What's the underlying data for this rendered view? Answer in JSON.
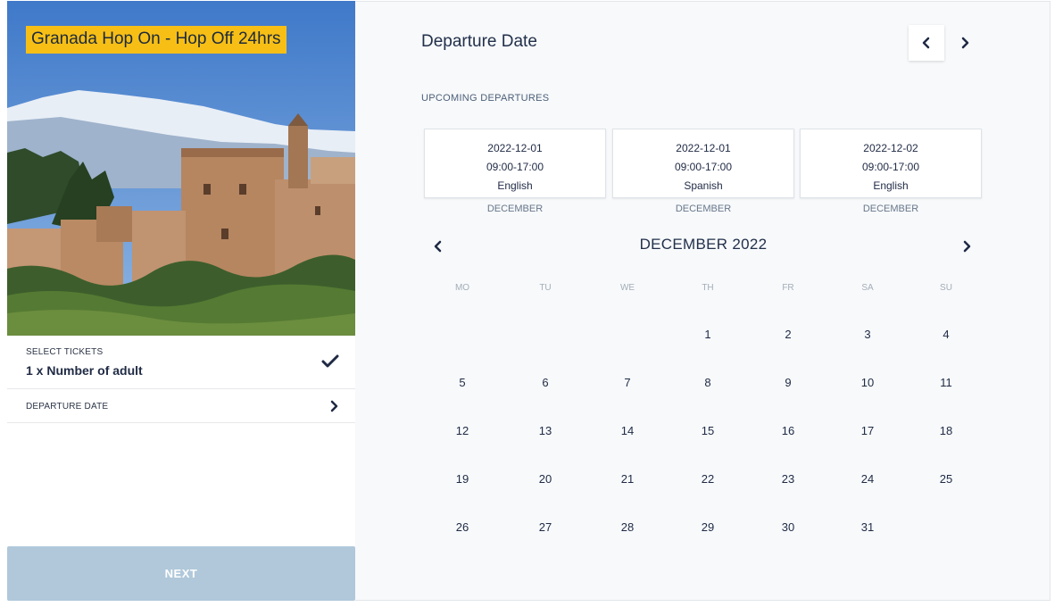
{
  "product": {
    "title": "Granada Hop On - Hop Off 24hrs"
  },
  "steps": {
    "tickets": {
      "label": "SELECT TICKETS",
      "value": "1 x Number of adult"
    },
    "departure": {
      "label": "DEPARTURE DATE"
    },
    "next_label": "NEXT"
  },
  "panel": {
    "heading": "Departure Date",
    "upcoming_label": "UPCOMING DEPARTURES"
  },
  "departures": [
    {
      "date": "2022-12-01",
      "time": "09:00-17:00",
      "language": "English",
      "month": "DECEMBER"
    },
    {
      "date": "2022-12-01",
      "time": "09:00-17:00",
      "language": "Spanish",
      "month": "DECEMBER"
    },
    {
      "date": "2022-12-02",
      "time": "09:00-17:00",
      "language": "English",
      "month": "DECEMBER"
    }
  ],
  "calendar": {
    "title": "DECEMBER 2022",
    "weekdays": [
      "MO",
      "TU",
      "WE",
      "TH",
      "FR",
      "SA",
      "SU"
    ],
    "weeks": [
      [
        "",
        "",
        "",
        "1",
        "2",
        "3",
        "4"
      ],
      [
        "5",
        "6",
        "7",
        "8",
        "9",
        "10",
        "11"
      ],
      [
        "12",
        "13",
        "14",
        "15",
        "16",
        "17",
        "18"
      ],
      [
        "19",
        "20",
        "21",
        "22",
        "23",
        "24",
        "25"
      ],
      [
        "26",
        "27",
        "28",
        "29",
        "30",
        "31",
        ""
      ]
    ]
  },
  "icons": {
    "check": "check-icon",
    "chevron_right": "chevron-right-icon",
    "chevron_left": "chevron-left-icon"
  },
  "colors": {
    "badge": "#f7bf16",
    "next_button": "#b0c8da",
    "text": "#1f2a44"
  }
}
